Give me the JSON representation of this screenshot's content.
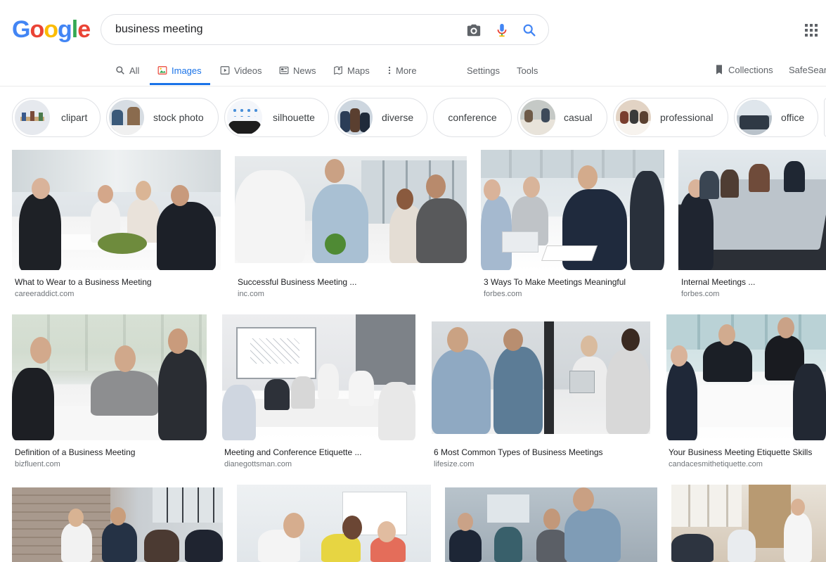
{
  "search": {
    "query": "business meeting"
  },
  "logo": {
    "text": "Google"
  },
  "tabs": [
    {
      "label": "All",
      "icon": "search-icon"
    },
    {
      "label": "Images",
      "icon": "image-icon"
    },
    {
      "label": "Videos",
      "icon": "play-icon"
    },
    {
      "label": "News",
      "icon": "news-icon"
    },
    {
      "label": "Maps",
      "icon": "map-icon"
    },
    {
      "label": "More",
      "icon": "kebab-icon"
    }
  ],
  "tools": {
    "settings": "Settings",
    "tools": "Tools",
    "collections": "Collections",
    "safesearch": "SafeSear"
  },
  "chips": [
    {
      "label": "clipart"
    },
    {
      "label": "stock photo"
    },
    {
      "label": "silhouette"
    },
    {
      "label": "diverse"
    },
    {
      "label": "conference"
    },
    {
      "label": "casual"
    },
    {
      "label": "professional"
    },
    {
      "label": "office"
    }
  ],
  "results": [
    {
      "title": "What to Wear to a Business Meeting",
      "source": "careeraddict.com"
    },
    {
      "title": "Successful Business Meeting ...",
      "source": "inc.com"
    },
    {
      "title": "3 Ways To Make Meetings Meaningful",
      "source": "forbes.com"
    },
    {
      "title": "Internal Meetings ...",
      "source": "forbes.com"
    },
    {
      "title": "Definition of a Business Meeting",
      "source": "bizfluent.com"
    },
    {
      "title": "Meeting and Conference Etiquette ...",
      "source": "dianegottsman.com"
    },
    {
      "title": "6 Most Common Types of Business Meetings",
      "source": "lifesize.com"
    },
    {
      "title": "Your Business Meeting Etiquette Skills",
      "source": "candacesmithetiquette.com"
    }
  ],
  "colors": {
    "accent": "#1a73e8",
    "g_blue": "#4285f4",
    "g_red": "#ea4335",
    "g_yellow": "#fbbc05",
    "g_green": "#34a853"
  }
}
